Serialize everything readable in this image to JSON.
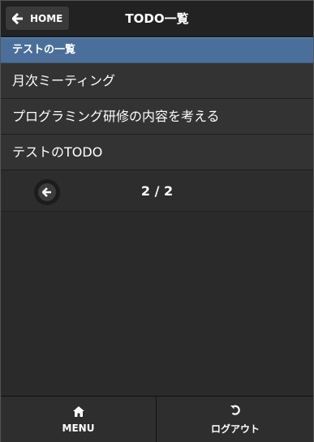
{
  "header": {
    "home_label": "HOME",
    "home_icon": "arrow-left-icon",
    "title": "TODO一覧"
  },
  "list": {
    "divider": "テストの一覧",
    "items": [
      {
        "label": "月次ミーティング"
      },
      {
        "label": "プログラミング研修の内容を考える"
      },
      {
        "label": "テストのTODO"
      }
    ]
  },
  "pager": {
    "prev_icon": "arrow-left-icon",
    "page_text": "2 / 2"
  },
  "footer": {
    "menu_label": "MENU",
    "menu_icon": "home-icon",
    "logout_label": "ログアウト",
    "logout_icon": "undo-icon"
  },
  "colors": {
    "background": "#2a2a2a",
    "header": "#222222",
    "divider": "#4a6f9a",
    "list_item": "#333333"
  }
}
